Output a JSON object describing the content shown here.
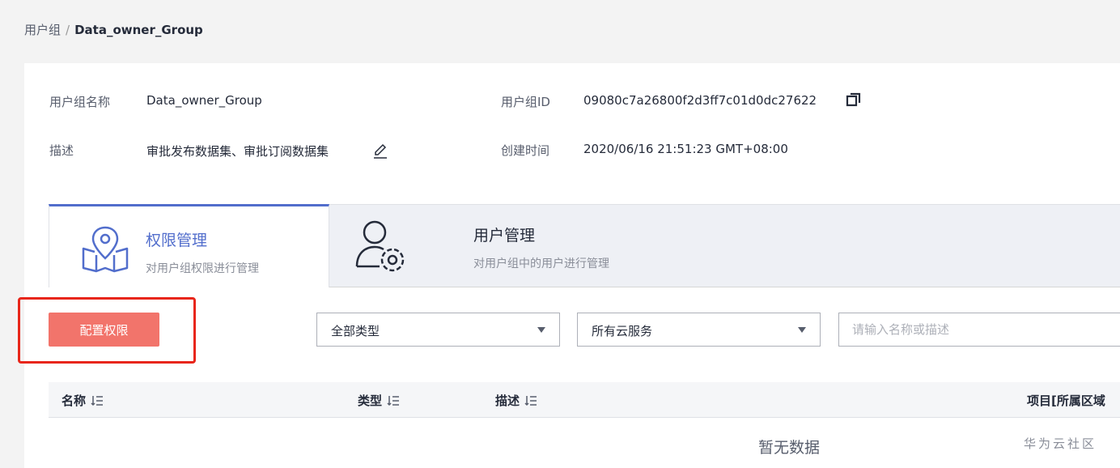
{
  "breadcrumb": {
    "parent": "用户组",
    "separator": "/",
    "current": "Data_owner_Group"
  },
  "info": {
    "name_label": "用户组名称",
    "name_value": "Data_owner_Group",
    "desc_label": "描述",
    "desc_value": "审批发布数据集、审批订阅数据集",
    "id_label": "用户组ID",
    "id_value": "09080c7a26800f2d3ff7c01d0dc27622",
    "created_label": "创建时间",
    "created_value": "2020/06/16 21:51:23 GMT+08:00"
  },
  "tabs": [
    {
      "title": "权限管理",
      "desc": "对用户组权限进行管理",
      "icon": "map-pin-icon"
    },
    {
      "title": "用户管理",
      "desc": "对用户组中的用户进行管理",
      "icon": "user-gear-icon"
    }
  ],
  "toolbar": {
    "config_button": "配置权限",
    "type_select": "全部类型",
    "service_select": "所有云服务",
    "search_placeholder": "请输入名称或描述"
  },
  "table": {
    "columns": [
      "名称",
      "类型",
      "描述",
      "项目[所属区域"
    ],
    "empty_text": "暂无数据"
  },
  "watermark": "华为云社区",
  "colors": {
    "primary": "#f2746b",
    "accent": "#526ecc",
    "highlight": "#e8261a"
  }
}
